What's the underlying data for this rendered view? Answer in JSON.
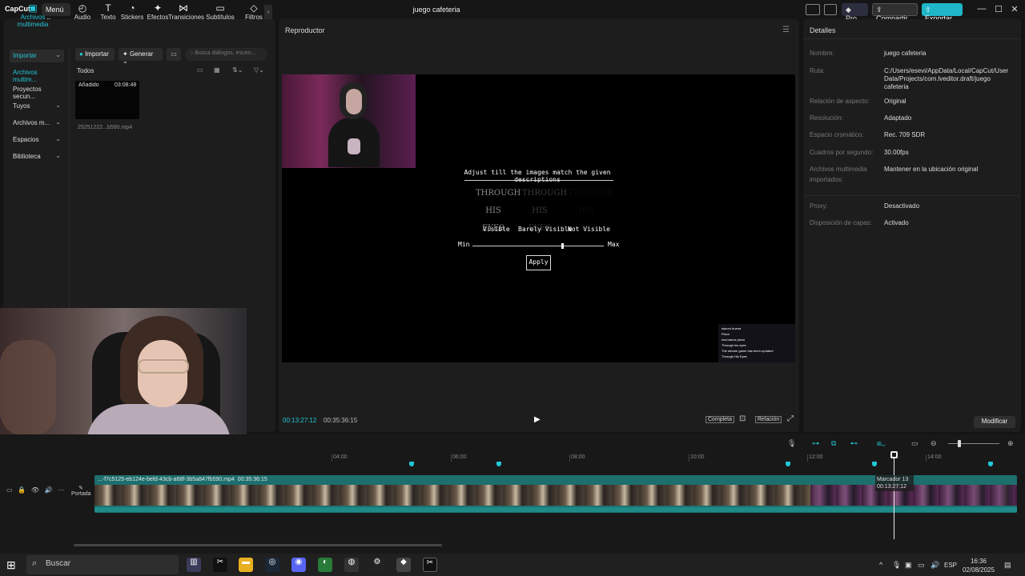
{
  "titlebar": {
    "app_logo": "CapCut",
    "menu_label": "Menú",
    "project_title": "juego cafeteria",
    "pro_label": "Pro",
    "share_label": "Compartir",
    "export_label": "Exportar",
    "accent": "#24c6d8"
  },
  "tool_tabs": [
    {
      "label": "Archivos multimedia",
      "icon": "media-icon",
      "glyph": "▣"
    },
    {
      "label": "Audio",
      "icon": "audio-icon",
      "glyph": "◴"
    },
    {
      "label": "Texto",
      "icon": "text-icon",
      "glyph": "T"
    },
    {
      "label": "Stickers",
      "icon": "sticker-icon",
      "glyph": "◔"
    },
    {
      "label": "Efectos",
      "icon": "effects-icon",
      "glyph": "✦"
    },
    {
      "label": "Transiciones",
      "icon": "transitions-icon",
      "glyph": "⋈"
    },
    {
      "label": "Subtítulos",
      "icon": "subtitles-icon",
      "glyph": "▭"
    },
    {
      "label": "Filtros",
      "icon": "filters-icon",
      "glyph": "◇"
    }
  ],
  "sidebar": {
    "items": [
      {
        "label": "Importar",
        "has_chevron": true
      },
      {
        "label": "Archivos multim...",
        "has_chevron": false
      },
      {
        "label": "Proyectos secun...",
        "has_chevron": false
      },
      {
        "label": "Tuyos",
        "has_chevron": true
      },
      {
        "label": "Archivos m...",
        "has_chevron": true
      },
      {
        "label": "Espacios",
        "has_chevron": true
      },
      {
        "label": "Biblioteca",
        "has_chevron": true
      }
    ]
  },
  "media": {
    "import_label": "Importar",
    "generate_label": "Generar",
    "search_placeholder": "Busca diálogos, escen...",
    "filter_all": "Todos",
    "item": {
      "badge": "Añadido",
      "duration": "03:08:48",
      "name": "25251222...b590.mp4"
    }
  },
  "player": {
    "title": "Reproductor",
    "current_time": "00:13:27:12",
    "total_time": "00:35:36:15",
    "full_label": "Completa",
    "ratio_label": "Relación",
    "game": {
      "heading": "Adjust till the images match the given descriptions",
      "image_text": "THROUGH HIS EYES",
      "labels": [
        "Visible",
        "Barely Visible",
        "Not Visible"
      ],
      "min": "Min",
      "max": "Max",
      "slider_value": 0.68,
      "apply": "Apply"
    },
    "chat": [
      "sakuro buena",
      "Pizza",
      "esa banca pizza",
      "Through his eyes",
      "The stream game has been updated",
      "Through His Eyes"
    ]
  },
  "details": {
    "title": "Detalles",
    "rows": [
      {
        "key": "Nombre:",
        "value": "juego cafeteria"
      },
      {
        "key": "Ruta:",
        "value": "C:/Users/esevi/AppData/Local/CapCut/User Data/Projects/com.lveditor.draft/juego cafeteria"
      },
      {
        "key": "Relación de aspecto:",
        "value": "Original"
      },
      {
        "key": "Resolución:",
        "value": "Adaptado"
      },
      {
        "key": "Espacio cromático:",
        "value": "Rec. 709 SDR"
      },
      {
        "key": "Cuadros por segundo:",
        "value": "30.00fps"
      },
      {
        "key": "Archivos multimedia importados:",
        "value": "Mantener en la ubicación original"
      },
      {
        "key": "Proxy:",
        "value": "Desactivado"
      },
      {
        "key": "Disposición de capas:",
        "value": "Activado"
      }
    ],
    "modify_label": "Modificar"
  },
  "timeline": {
    "ruler": [
      "04:00",
      "06:00",
      "08:00",
      "10:00",
      "12:00",
      "14:00"
    ],
    "cover_label": "Portada",
    "clip_name": "...-f7c5125-eb124e-befd-43cb-a68f-3b5a847fb590.mp4",
    "clip_duration": "00:35:36:15",
    "marker_label": "Marcador 13",
    "marker_time": "00:13:27:12"
  },
  "taskbar": {
    "search_label": "Buscar",
    "lang": "ESP",
    "time": "16:36",
    "date": "02/08/2025"
  }
}
